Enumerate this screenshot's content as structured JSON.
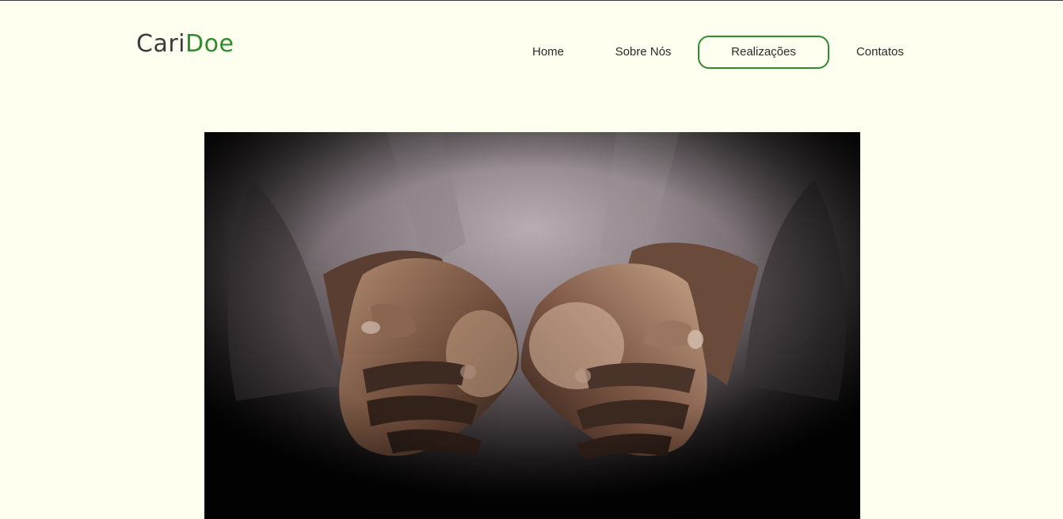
{
  "brand": {
    "part1": "Cari",
    "part2": "Doe",
    "accent_color": "#2e8b2e",
    "text_color": "#3b3b3b"
  },
  "nav": {
    "items": [
      {
        "label": "Home",
        "active": false
      },
      {
        "label": "Sobre Nós",
        "active": false
      },
      {
        "label": "Realizações",
        "active": true
      },
      {
        "label": "Contatos",
        "active": false
      }
    ]
  },
  "hero": {
    "image": "cupped-hands-photo"
  },
  "colors": {
    "background": "#fffff0",
    "accent": "#2e8b2e"
  }
}
